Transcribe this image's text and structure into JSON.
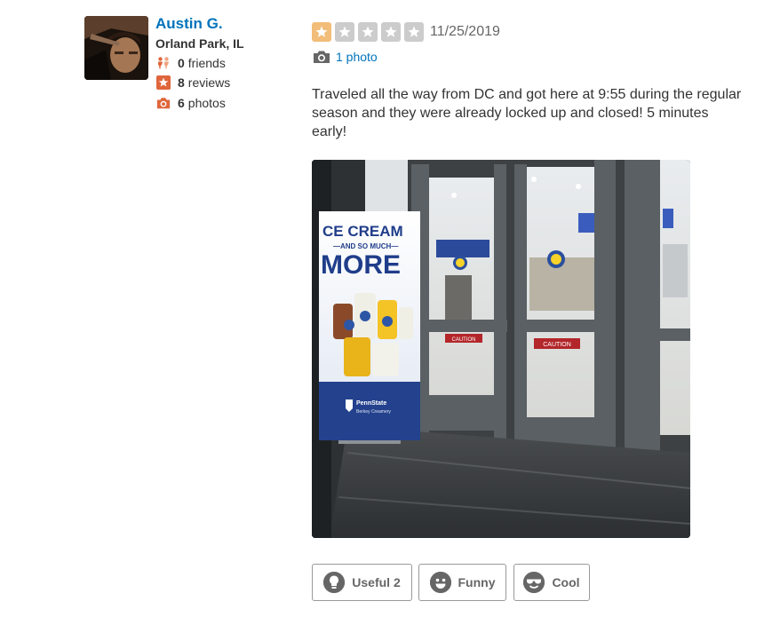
{
  "user": {
    "name": "Austin G.",
    "location": "Orland Park, IL",
    "friends": {
      "count": "0",
      "label": "friends"
    },
    "reviews": {
      "count": "8",
      "label": "reviews"
    },
    "photos": {
      "count": "6",
      "label": "photos"
    }
  },
  "review": {
    "rating": 1,
    "rating_max": 5,
    "date": "11/25/2019",
    "photo_link": "1 photo",
    "text": "Traveled all the way from DC and got here at 9:55 during the regular season and they were already locked up and closed!  5 minutes early!",
    "photo": {
      "banner_line1": "CE CREAM",
      "banner_line2": "—AND SO MUCH—",
      "banner_line3": "MORE",
      "banner_brand_1": "PennState",
      "banner_brand_2": "Berkey Creamery",
      "door_sign": "CAUTION",
      "door_sign_2": "CAUTION"
    }
  },
  "votes": {
    "useful": "Useful 2",
    "funny": "Funny",
    "cool": "Cool"
  },
  "colors": {
    "link": "#0073bb",
    "star_filled": "#f2bd79",
    "star_empty": "#cccccc",
    "stat_icon": "#e0653b"
  }
}
